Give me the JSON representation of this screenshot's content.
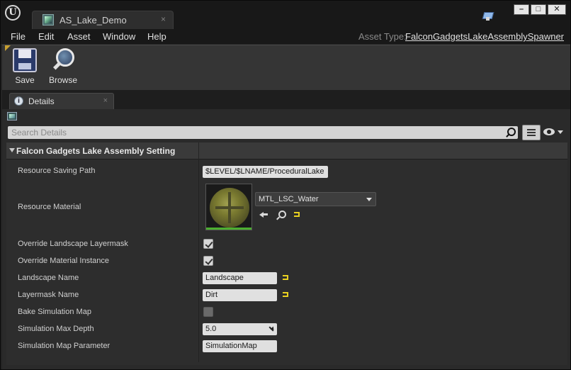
{
  "window": {
    "tab_title": "AS_Lake_Demo",
    "tab_close": "×",
    "min_label": "–",
    "max_label": "□",
    "close_label": "✕"
  },
  "menu": {
    "items": [
      "File",
      "Edit",
      "Asset",
      "Window",
      "Help"
    ],
    "asset_type_label": "Asset Type:",
    "asset_type_value": "FalconGadgetsLakeAssemblySpawner"
  },
  "toolbar": {
    "save_label": "Save",
    "browse_label": "Browse"
  },
  "details": {
    "tab_title": "Details",
    "tab_close": "×",
    "search_placeholder": "Search Details",
    "category_title": "Falcon Gadgets Lake Assembly Setting",
    "properties": [
      {
        "label": "Resource Saving Path",
        "value": "$LEVEL/$LNAME/ProceduralLake"
      },
      {
        "label": "Resource Material",
        "value": "MTL_LSC_Water"
      },
      {
        "label": "Override Landscape Layermask",
        "checked": true
      },
      {
        "label": "Override Material Instance",
        "checked": true
      },
      {
        "label": "Landscape Name",
        "value": "Landscape"
      },
      {
        "label": "Layermask Name",
        "value": "Dirt"
      },
      {
        "label": "Bake Simulation Map",
        "checked": false
      },
      {
        "label": "Simulation Max Depth",
        "value": "5.0"
      },
      {
        "label": "Simulation Map Parameter",
        "value": "SimulationMap"
      }
    ]
  },
  "colors": {
    "accent": "#c8a030",
    "reset_arrow": "#e8d020",
    "thumbnail_bar": "#4caf30"
  },
  "icons": [
    "unreal-logo-icon",
    "asset-icon",
    "notification-icon",
    "save-icon",
    "browse-icon",
    "details-icon",
    "search-icon",
    "list-view-icon",
    "eye-icon",
    "use-selected-icon",
    "browse-to-icon",
    "reset-to-default-icon"
  ]
}
